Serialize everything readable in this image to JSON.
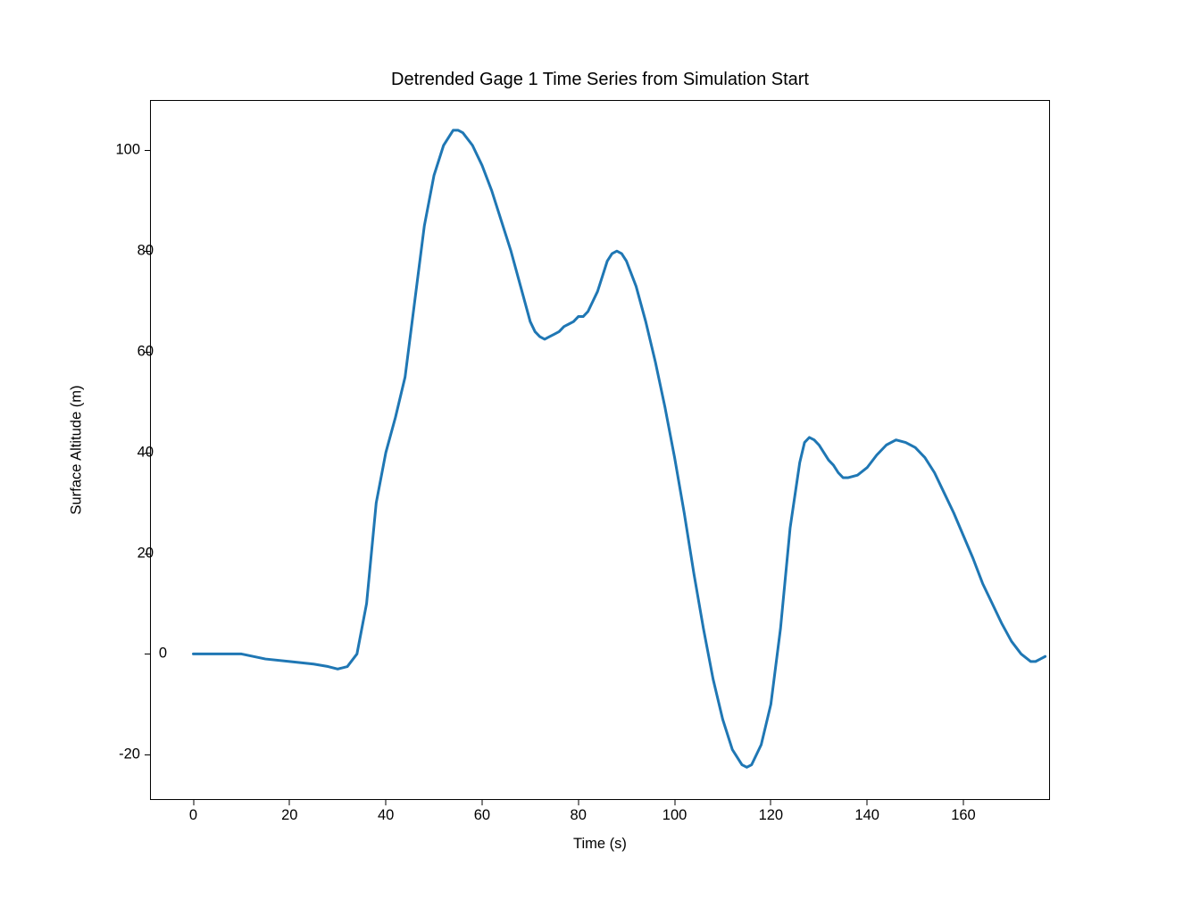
{
  "chart_data": {
    "type": "line",
    "title": "Detrended Gage 1 Time Series from Simulation Start",
    "xlabel": "Time (s)",
    "ylabel": "Surface Altitude (m)",
    "xlim": [
      -9,
      178
    ],
    "ylim": [
      -29,
      110
    ],
    "xticks": [
      0,
      20,
      40,
      60,
      80,
      100,
      120,
      140,
      160
    ],
    "yticks": [
      -20,
      0,
      20,
      40,
      60,
      80,
      100
    ],
    "x": [
      0,
      5,
      10,
      15,
      20,
      25,
      28,
      30,
      32,
      34,
      36,
      37,
      38,
      40,
      42,
      44,
      46,
      48,
      50,
      52,
      54,
      55,
      56,
      58,
      60,
      62,
      64,
      66,
      68,
      70,
      71,
      72,
      73,
      74,
      75,
      76,
      77,
      78,
      79,
      80,
      81,
      82,
      83,
      84,
      85,
      86,
      87,
      88,
      89,
      90,
      92,
      94,
      96,
      98,
      100,
      102,
      104,
      106,
      108,
      110,
      112,
      114,
      115,
      116,
      118,
      120,
      122,
      124,
      126,
      127,
      128,
      129,
      130,
      131,
      132,
      133,
      134,
      135,
      136,
      138,
      140,
      142,
      144,
      146,
      148,
      150,
      152,
      154,
      156,
      158,
      160,
      162,
      164,
      166,
      168,
      170,
      172,
      174,
      175,
      176,
      177
    ],
    "values": [
      0,
      0,
      0,
      -1,
      -1.5,
      -2,
      -2.5,
      -3,
      -2.5,
      0,
      10,
      20,
      30,
      40,
      47,
      55,
      70,
      85,
      95,
      101,
      104,
      104,
      103.5,
      101,
      97,
      92,
      86,
      80,
      73,
      66,
      64,
      63,
      62.5,
      63,
      63.5,
      64,
      65,
      65.5,
      66,
      67,
      67,
      68,
      70,
      72,
      75,
      78,
      79.5,
      80,
      79.5,
      78,
      73,
      66,
      58,
      49,
      39,
      28,
      16,
      5,
      -5,
      -13,
      -19,
      -22,
      -22.5,
      -22,
      -18,
      -10,
      5,
      25,
      38,
      42,
      43,
      42.5,
      41.5,
      40,
      38.5,
      37.5,
      36,
      35,
      35,
      35.5,
      37,
      39.5,
      41.5,
      42.5,
      42,
      41,
      39,
      36,
      32,
      28,
      23.5,
      19,
      14,
      10,
      6,
      2.5,
      0,
      -1.5,
      -1.5,
      -1,
      -0.5
    ]
  }
}
